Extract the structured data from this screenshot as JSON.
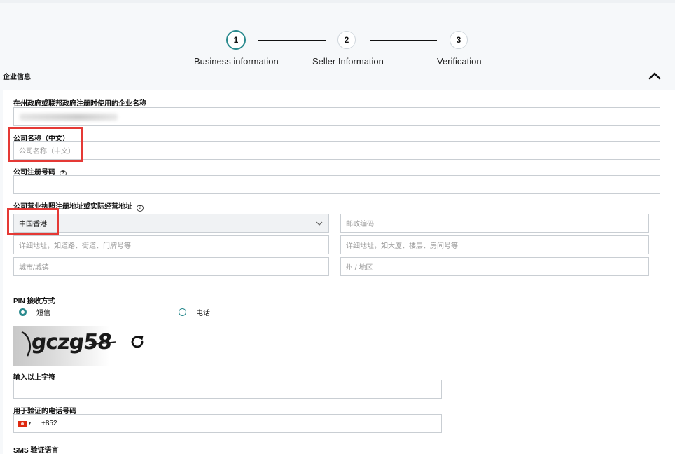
{
  "stepper": {
    "steps": [
      {
        "number": "1",
        "label": "Business information"
      },
      {
        "number": "2",
        "label": "Seller Information"
      },
      {
        "number": "3",
        "label": "Verification"
      }
    ]
  },
  "section": {
    "title": "企业信息"
  },
  "form": {
    "company_name_label": "在州政府或联邦政府注册时使用的企业名称",
    "company_name_cn_label": "公司名称（中文）",
    "company_name_cn_placeholder": "公司名称（中文）",
    "reg_number_label": "公司注册号码",
    "reg_number_help": "?",
    "address_label": "公司营业执照注册地址或实际经营地址",
    "address_help": "?",
    "country_value": "中国香港",
    "postal_placeholder": "邮政编码",
    "address1_placeholder": "详细地址，如道路、街道、门牌号等",
    "address2_placeholder": "详细地址，如大厦、楼层、房间号等",
    "city_placeholder": "城市/城镇",
    "state_placeholder": "州 / 地区",
    "pin_label": "PIN 接收方式",
    "pin_options": [
      {
        "label": "短信",
        "selected": true
      },
      {
        "label": "电话",
        "selected": false
      }
    ],
    "captcha_text": "gczg58",
    "captcha_input_label": "输入以上字符",
    "phone_label": "用于验证的电话号码",
    "phone_code": "+852",
    "sms_lang_label": "SMS 验证语言"
  },
  "colors": {
    "accent": "#2a8a8e",
    "highlight": "#e53935"
  }
}
